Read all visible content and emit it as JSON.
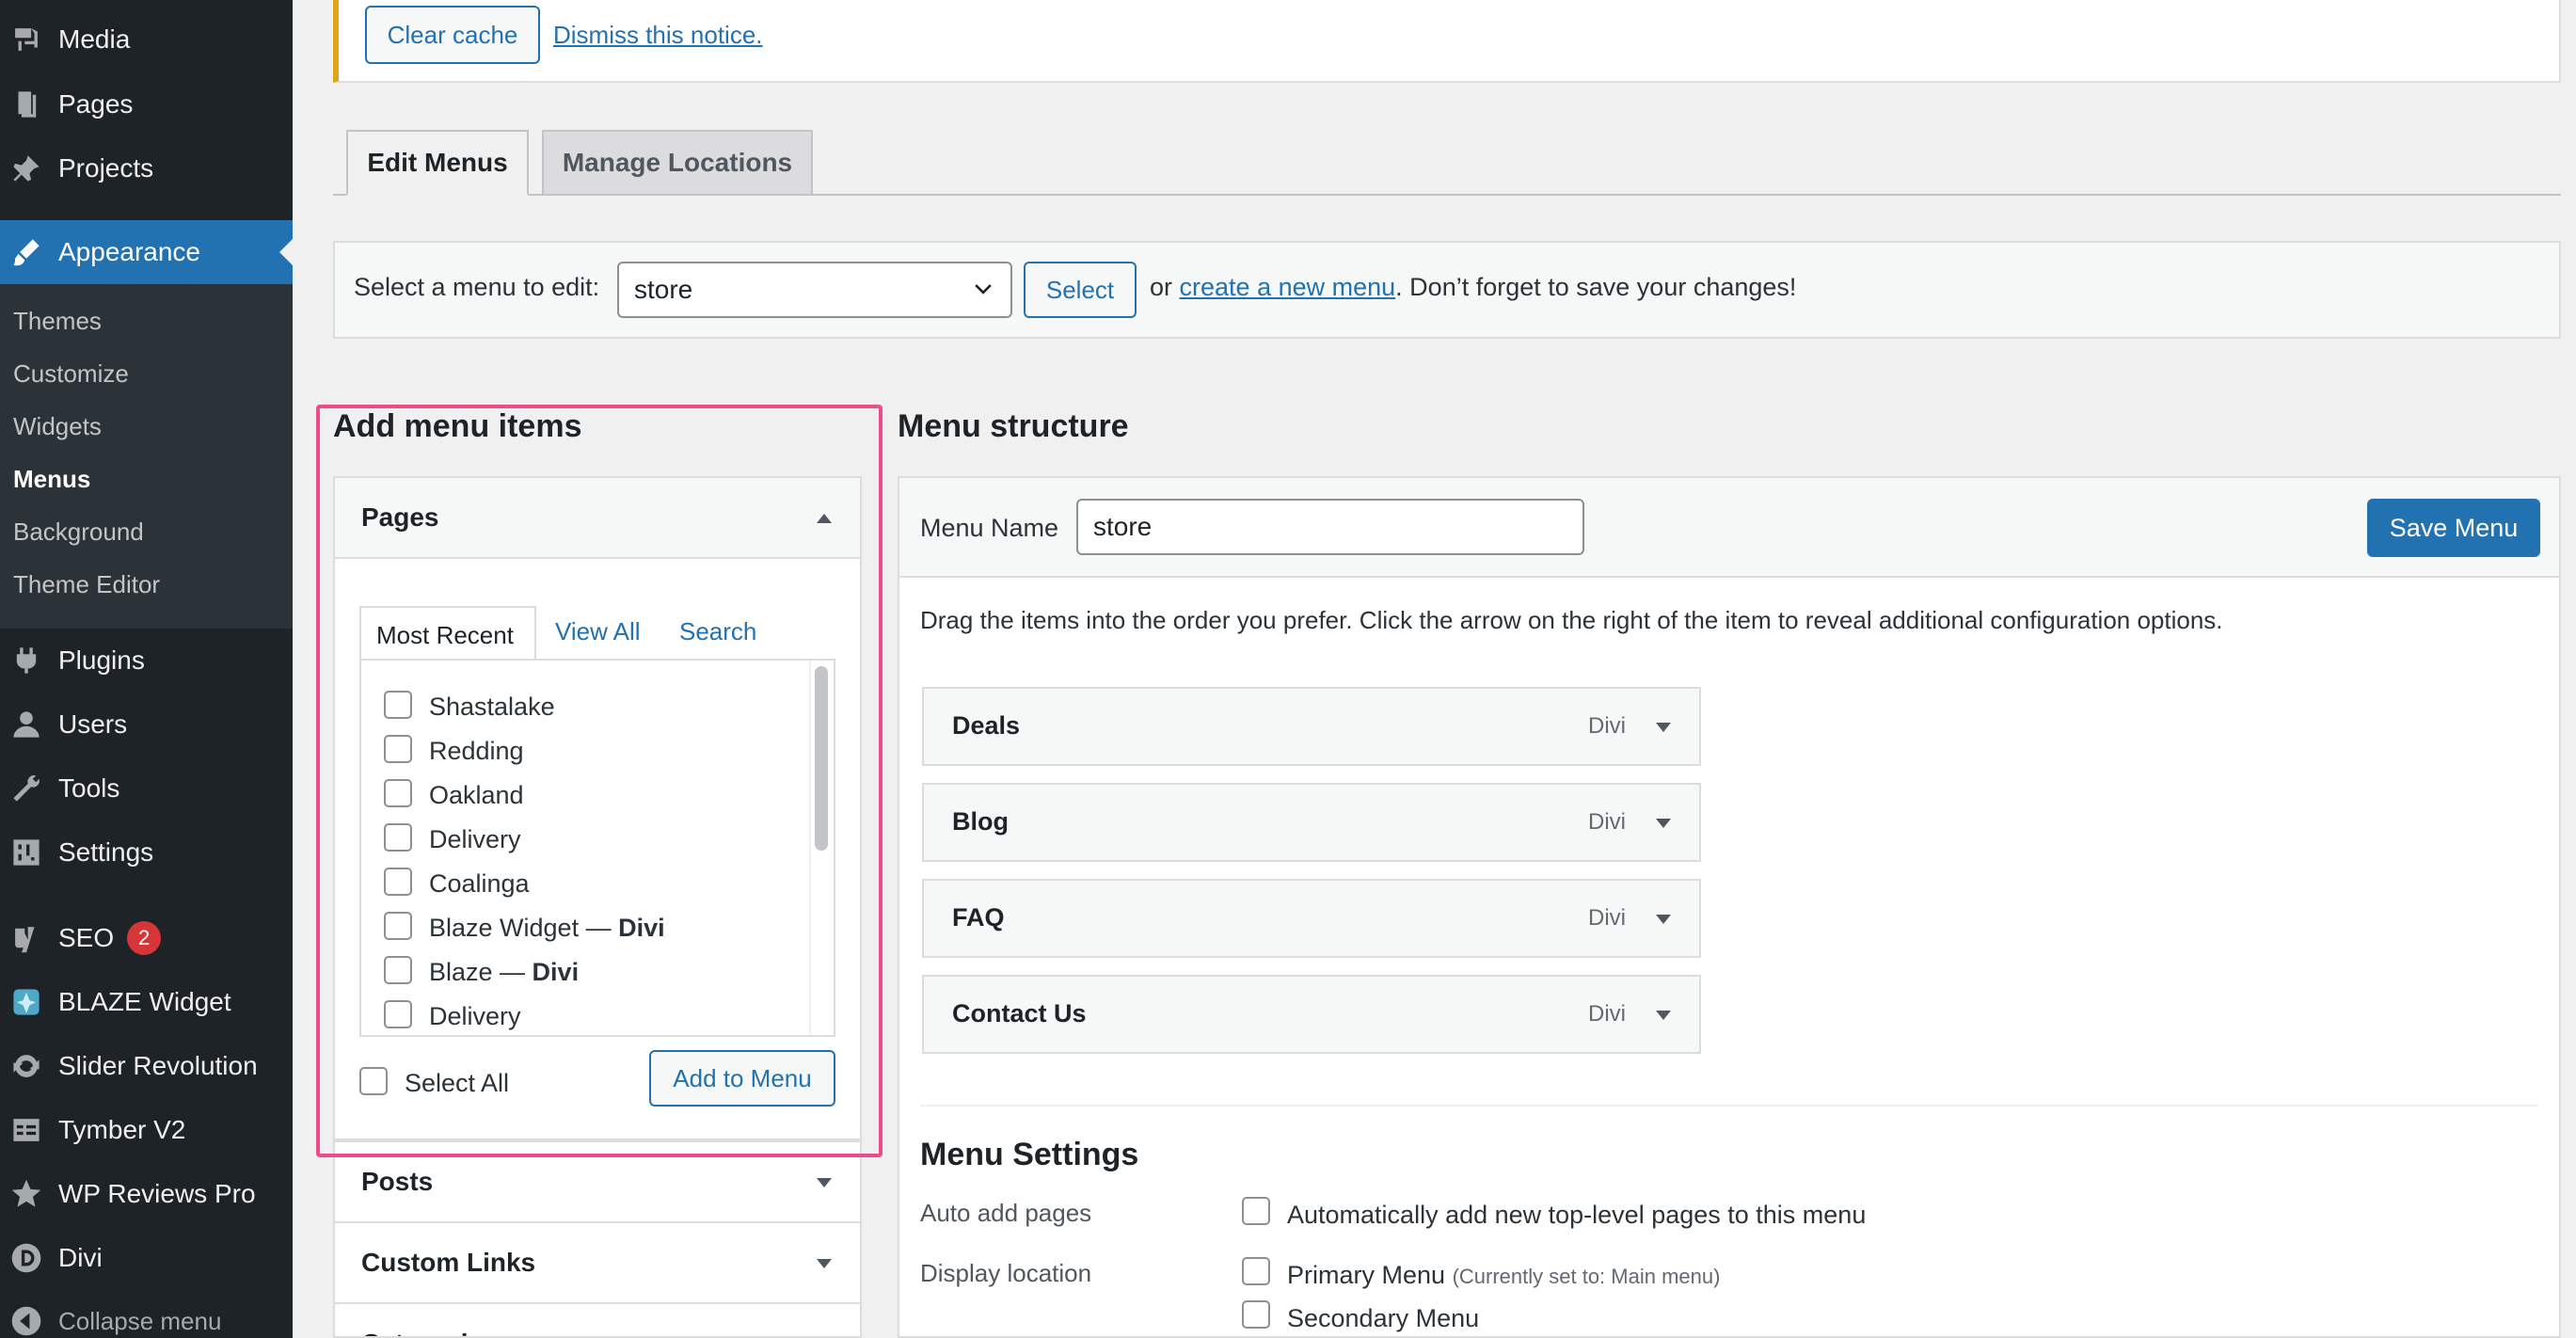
{
  "sidebar": {
    "items": [
      {
        "label": "Media",
        "icon": "media-icon"
      },
      {
        "label": "Pages",
        "icon": "pages-icon"
      },
      {
        "label": "Projects",
        "icon": "pin-icon"
      },
      {
        "label": "Appearance",
        "icon": "brush-icon"
      },
      {
        "label": "Plugins",
        "icon": "plugin-icon"
      },
      {
        "label": "Users",
        "icon": "user-icon"
      },
      {
        "label": "Tools",
        "icon": "wrench-icon"
      },
      {
        "label": "Settings",
        "icon": "settings-icon"
      },
      {
        "label": "SEO",
        "icon": "yoast-icon",
        "badge": "2"
      },
      {
        "label": "BLAZE Widget",
        "icon": "blaze-icon"
      },
      {
        "label": "Slider Revolution",
        "icon": "refresh-icon"
      },
      {
        "label": "Tymber V2",
        "icon": "table-icon"
      },
      {
        "label": "WP Reviews Pro",
        "icon": "star-icon"
      },
      {
        "label": "Divi",
        "icon": "divi-icon"
      },
      {
        "label": "Collapse menu",
        "icon": "collapse-icon"
      }
    ],
    "submenu": [
      "Themes",
      "Customize",
      "Widgets",
      "Menus",
      "Background",
      "Theme Editor"
    ]
  },
  "notice": {
    "clear_cache": "Clear cache",
    "dismiss": "Dismiss this notice."
  },
  "tabs": {
    "edit_menus": "Edit Menus",
    "manage_locations": "Manage Locations"
  },
  "menu_select": {
    "label": "Select a menu to edit:",
    "value": "store",
    "button": "Select",
    "or": "or",
    "create_link": "create a new menu",
    "suffix": ". Don’t forget to save your changes!"
  },
  "add_items": {
    "heading": "Add menu items",
    "pages_title": "Pages",
    "tabs": [
      "Most Recent",
      "View All",
      "Search"
    ],
    "pages": [
      {
        "name": "Shastalake",
        "suffix": ""
      },
      {
        "name": "Redding",
        "suffix": ""
      },
      {
        "name": "Oakland",
        "suffix": ""
      },
      {
        "name": "Delivery",
        "suffix": ""
      },
      {
        "name": "Coalinga",
        "suffix": ""
      },
      {
        "name": "Blaze Widget — ",
        "suffix": "Divi"
      },
      {
        "name": "Blaze — ",
        "suffix": "Divi"
      },
      {
        "name": "Delivery",
        "suffix": ""
      }
    ],
    "select_all": "Select All",
    "add_button": "Add to Menu",
    "posts_title": "Posts",
    "custom_links_title": "Custom Links",
    "categories_title": "Categories"
  },
  "structure": {
    "heading": "Menu structure",
    "name_label": "Menu Name",
    "name_value": "store",
    "save_button": "Save Menu",
    "instructions": "Drag the items into the order you prefer. Click the arrow on the right of the item to reveal additional configuration options.",
    "items": [
      {
        "title": "Deals",
        "type": "Divi"
      },
      {
        "title": "Blog",
        "type": "Divi"
      },
      {
        "title": "FAQ",
        "type": "Divi"
      },
      {
        "title": "Contact Us",
        "type": "Divi"
      }
    ]
  },
  "settings": {
    "heading": "Menu Settings",
    "auto_add_label": "Auto add pages",
    "auto_add_option": "Automatically add new top-level pages to this menu",
    "display_label": "Display location",
    "primary": "Primary Menu",
    "primary_note": "(Currently set to: Main menu)",
    "secondary": "Secondary Menu"
  },
  "colors": {
    "sidebar_bg": "#1d2327",
    "accent": "#2271b1",
    "highlight": "#ed4c8a",
    "notice_border": "#dba617"
  }
}
